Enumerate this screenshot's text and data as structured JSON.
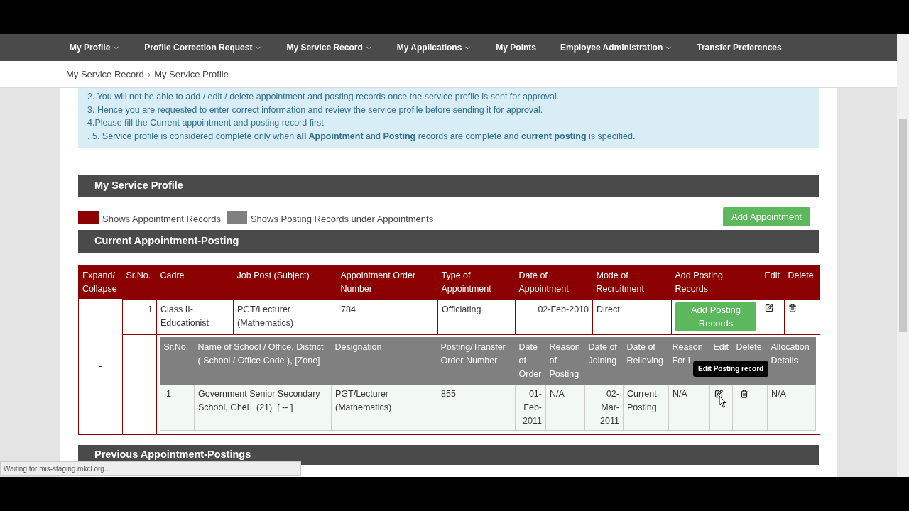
{
  "nav": [
    {
      "label": "My Profile",
      "dropdown": true
    },
    {
      "label": "Profile Correction Request",
      "dropdown": true
    },
    {
      "label": "My Service Record",
      "dropdown": true
    },
    {
      "label": "My Applications",
      "dropdown": true
    },
    {
      "label": "My Points",
      "dropdown": false
    },
    {
      "label": "Employee Administration",
      "dropdown": true
    },
    {
      "label": "Transfer Preferences",
      "dropdown": false
    }
  ],
  "breadcrumb": [
    "My Service Record",
    "My Service Profile"
  ],
  "breadcrumb_separator": "›",
  "notice": [
    "2. You will not be able to add / edit / delete appointment and posting records once the service profile is sent for approval.",
    "3. Hence you are requested to enter correct information and review the service profile before sending it for approval.",
    "4.Please fill the Current appointment and posting record first",
    ". 5. Service profile is considered complete only when **all Appointment** and **Posting** records are complete and **current posting** is specified."
  ],
  "profile_title": "My Service Profile",
  "legend": [
    {
      "label": "Shows Appointment Records",
      "color": "#8b0000"
    },
    {
      "label": "Shows Posting Records under Appointments",
      "color": "#808080"
    }
  ],
  "add_appointment": "Add Appointment",
  "current_title": "Current Appointment-Posting",
  "table": {
    "columns": [
      "Expand/ Collapse",
      "Sr.No.",
      "Cadre",
      "Job Post (Subject)",
      "Appointment Order Number",
      "Type of Appointment",
      "Date of Appointment",
      "Mode of Recruitment",
      "Add Posting Records",
      "Edit",
      "Delete"
    ],
    "rows": [
      {
        "toggle": "-",
        "sr": "1",
        "cadre": "Class II-Educationist",
        "job_post": "PGT/Lecturer (Mathematics)",
        "order_number": "784",
        "type": "Officiating",
        "date": "02-Feb-2010",
        "mode": "Direct",
        "add_posting": "Add Posting Records",
        "postings": {
          "columns": [
            "Sr.No.",
            "Name of School / Office, District ( School / Office Code ), [Zone]",
            "Designation",
            "Posting/Transfer Order Number",
            "Date of Order",
            "Reason of Posting",
            "Date of Joining",
            "Date of Relieving",
            "Reason For L",
            "Edit",
            "Delete",
            "Allocation Details"
          ],
          "rows": [
            {
              "sr": "1",
              "school": "Government Senior Secondary School, Ghel   (21)  [ -- ]",
              "designation": "PGT/Lecturer (Mathematics)",
              "order_number": "855",
              "date_of_order": "01-Feb-2011",
              "reason": "N/A",
              "date_of_joining": "02-Mar-2011",
              "relieving": "Current Posting",
              "reason_leaving": "N/A",
              "allocation": "N/A",
              "edit_tooltip": "Edit Posting record"
            }
          ]
        }
      }
    ]
  },
  "previous_title": "Previous Appointment-Postings",
  "status": "Waiting for mis-staging.mkcl.org..."
}
